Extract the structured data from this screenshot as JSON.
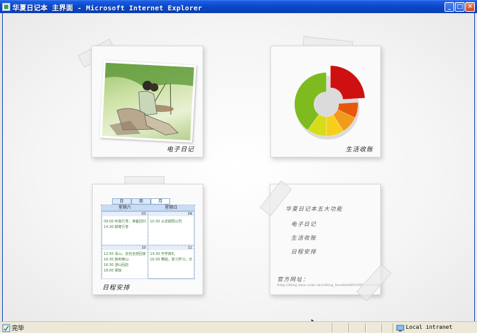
{
  "window": {
    "title": "华夏日记本 主界面 - Microsoft Internet Explorer",
    "minimize_label": "_",
    "maximize_label": "□",
    "close_label": "✕"
  },
  "cards": {
    "diary": {
      "label": "电子日记"
    },
    "finance": {
      "label": "生活收账",
      "chart_data": {
        "type": "pie",
        "values": [
          24,
          8,
          9,
          9,
          10,
          40
        ],
        "colors": [
          "#cf1010",
          "#e8580b",
          "#f29a1c",
          "#f7cf1a",
          "#d6dc1a",
          "#7dbb1e"
        ]
      }
    },
    "schedule": {
      "label": "日程安排",
      "tabs": [
        "日",
        "周",
        "月"
      ],
      "headers": [
        "星期六",
        "星期日"
      ],
      "cells": [
        {
          "day": "03",
          "lines": [
            "09:00 听故行李，准备回归",
            "14:30 邮寄行李"
          ]
        },
        {
          "day": "04",
          "lines": [
            "10:30 从去邮局公司"
          ]
        },
        {
          "day": "10",
          "lines": [
            "12:50 青山，去完全部回家",
            "16:30 跑到黄山",
            "16:30 游山回店",
            "18:00 做饭"
          ]
        },
        {
          "day": "11",
          "lines": [
            "14:30 开学典礼",
            "16:30 舞蹈，复习学习，日"
          ]
        }
      ]
    },
    "about": {
      "heading": "华夏日记本五大功能",
      "features": [
        "电子日记",
        "生活收账",
        "日程安排"
      ],
      "site_label": "官方网址：",
      "site_url": "http://blog.sina.com.cn/s/blog_boodde6f0100jvwn.html"
    }
  },
  "statusbar": {
    "status": "完毕",
    "zone": "Local intranet"
  }
}
